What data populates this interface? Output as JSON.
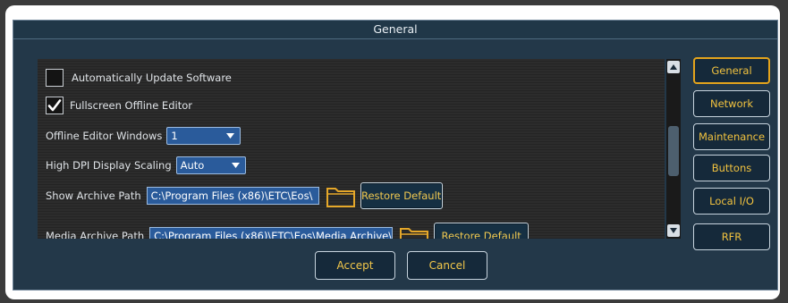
{
  "dialog": {
    "title": "General"
  },
  "settings": {
    "auto_update_label": "Automatically Update Software",
    "auto_update_checked": false,
    "fullscreen_label": "Fullscreen Offline Editor",
    "fullscreen_checked": true,
    "offline_windows_label": "Offline Editor Windows",
    "offline_windows_value": "1",
    "dpi_label": "High DPI Display Scaling",
    "dpi_value": "Auto",
    "archive_label": "Show Archive Path",
    "archive_path": "C:\\Program Files (x86)\\ETC\\Eos\\",
    "archive_restore": "Restore Default",
    "media_label": "Media Archive Path",
    "media_path": "C:\\Program Files (x86)\\ETC\\Eos\\Media Archive\\",
    "media_restore": "Restore Default"
  },
  "sidebar": {
    "items": [
      {
        "label": "General",
        "active": true
      },
      {
        "label": "Network"
      },
      {
        "label": "Maintenance"
      },
      {
        "label": "Buttons"
      },
      {
        "label": "Local I/O"
      },
      {
        "label": "RFR"
      }
    ]
  },
  "footer": {
    "accept": "Accept",
    "cancel": "Cancel"
  },
  "icons": {
    "checkmark": "check-icon",
    "dropdown": "chevron-down-icon",
    "folder": "folder-icon",
    "scroll_up": "arrow-up-icon",
    "scroll_down": "arrow-down-icon"
  },
  "colors": {
    "accent_gold": "#f0c850",
    "active_border": "#e4a41c",
    "field_blue": "#2a5b9b",
    "dialog_bg": "#233849"
  }
}
